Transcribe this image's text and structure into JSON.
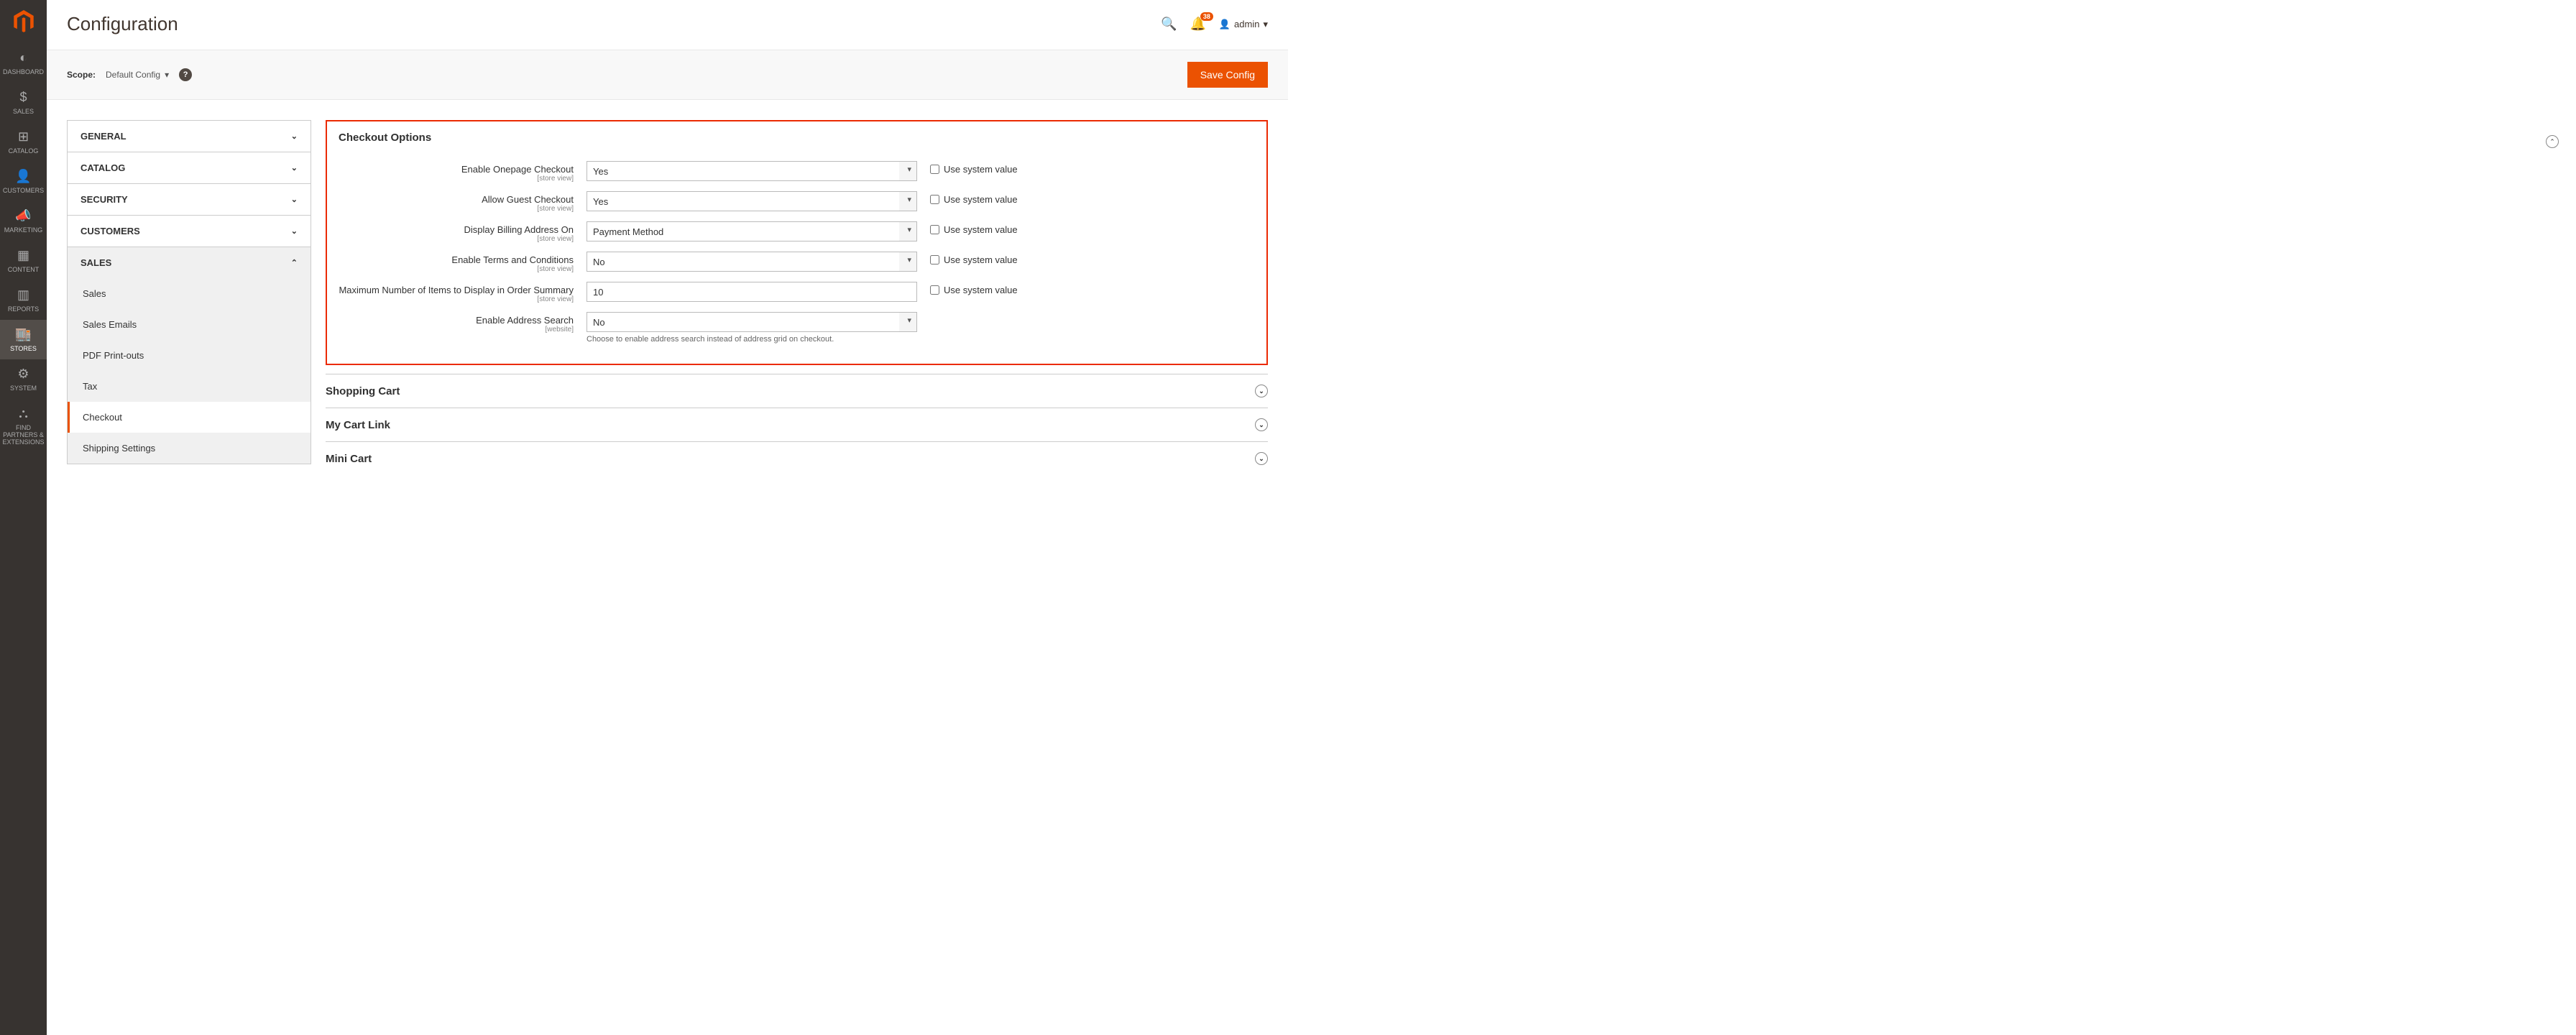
{
  "sidebar": {
    "items": [
      {
        "icon": "dashboard",
        "label": "DASHBOARD"
      },
      {
        "icon": "sales",
        "label": "SALES"
      },
      {
        "icon": "catalog",
        "label": "CATALOG"
      },
      {
        "icon": "customers",
        "label": "CUSTOMERS"
      },
      {
        "icon": "marketing",
        "label": "MARKETING"
      },
      {
        "icon": "content",
        "label": "CONTENT"
      },
      {
        "icon": "reports",
        "label": "REPORTS"
      },
      {
        "icon": "stores",
        "label": "STORES"
      },
      {
        "icon": "system",
        "label": "SYSTEM"
      },
      {
        "icon": "partners",
        "label": "FIND PARTNERS & EXTENSIONS"
      }
    ]
  },
  "header": {
    "title": "Configuration",
    "notification_count": "38",
    "user_label": "admin"
  },
  "scope": {
    "label": "Scope:",
    "value": "Default Config",
    "save_btn": "Save Config"
  },
  "nav": {
    "general": "GENERAL",
    "catalog": "CATALOG",
    "security": "SECURITY",
    "customers": "CUSTOMERS",
    "sales": "SALES",
    "sales_items": {
      "sales": "Sales",
      "emails": "Sales Emails",
      "pdf": "PDF Print-outs",
      "tax": "Tax",
      "checkout": "Checkout",
      "shipping": "Shipping Settings"
    }
  },
  "checkout": {
    "title": "Checkout Options",
    "use_system": "Use system value",
    "fields": {
      "onepage": {
        "label": "Enable Onepage Checkout",
        "scope": "[store view]",
        "value": "Yes"
      },
      "guest": {
        "label": "Allow Guest Checkout",
        "scope": "[store view]",
        "value": "Yes"
      },
      "billing": {
        "label": "Display Billing Address On",
        "scope": "[store view]",
        "value": "Payment Method"
      },
      "terms": {
        "label": "Enable Terms and Conditions",
        "scope": "[store view]",
        "value": "No"
      },
      "max_items": {
        "label": "Maximum Number of Items to Display in Order Summary",
        "scope": "[store view]",
        "value": "10"
      },
      "address_search": {
        "label": "Enable Address Search",
        "scope": "[website]",
        "value": "No",
        "note": "Choose to enable address search instead of address grid on checkout."
      }
    },
    "sections": {
      "cart": "Shopping Cart",
      "link": "My Cart Link",
      "mini": "Mini Cart"
    }
  }
}
